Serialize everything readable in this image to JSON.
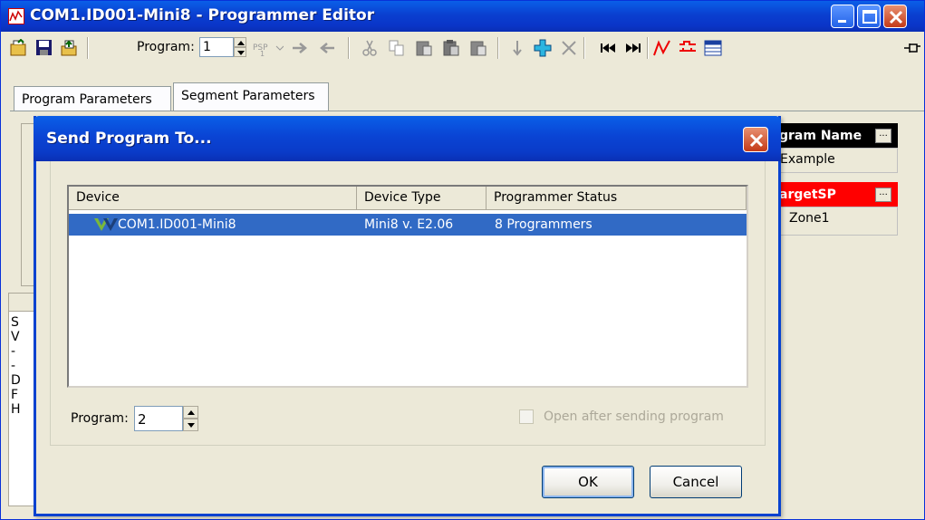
{
  "window": {
    "title": "COM1.ID001-Mini8 - Programmer Editor"
  },
  "toolbar": {
    "program_label": "Program:",
    "program_value": "1",
    "icons": [
      "open-icon",
      "save-icon",
      "upload-icon",
      "program-sp-icon",
      "forward-arrow-icon",
      "back-arrow-icon",
      "cut-icon",
      "copy-icon",
      "paste-icon",
      "paste-special-icon",
      "paste-all-icon",
      "insert-down-icon",
      "add-segment-icon",
      "delete-icon",
      "first-segment-icon",
      "last-segment-icon",
      "chart-icon",
      "channel-icon",
      "grid-icon",
      "pin-icon"
    ]
  },
  "tabs": [
    {
      "label": "Program Parameters"
    },
    {
      "label": "Segment Parameters"
    }
  ],
  "background": {
    "program_name_header": "gram Name",
    "program_name_value": "Example",
    "target_sp_header": "argetSP",
    "target_sp_value": "Zone1",
    "left_row_letters": [
      "S",
      "V",
      "-",
      "-",
      "D",
      "F",
      "H"
    ]
  },
  "dialog": {
    "title": "Send Program To...",
    "columns": [
      "Device",
      "Device Type",
      "Programmer Status"
    ],
    "rows": [
      {
        "device": "COM1.ID001-Mini8",
        "device_type": "Mini8 v. E2.06",
        "status": "8 Programmers"
      }
    ],
    "program_label": "Program:",
    "program_value": "2",
    "open_after_label": "Open after sending program",
    "ok_label": "OK",
    "cancel_label": "Cancel"
  },
  "colors": {
    "titlebar": "#0a44d4",
    "selection": "#316ac5",
    "target_sp_header": "#ff0000",
    "close_button": "#c43a18"
  }
}
